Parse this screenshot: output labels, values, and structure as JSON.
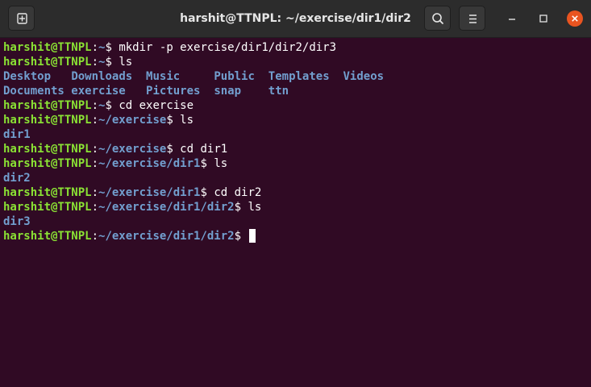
{
  "window": {
    "title": "harshit@TTNPL: ~/exercise/dir1/dir2",
    "colors": {
      "background": "#300a24",
      "titlebar": "#2c2c2c",
      "user": "#8ae234",
      "path": "#729fcf",
      "close": "#e95420"
    }
  },
  "terminal": {
    "user": "harshit@TTNPL",
    "sep": ":",
    "lines": [
      {
        "cwd": "~",
        "dollar": "$ ",
        "cmd": "mkdir -p exercise/dir1/dir2/dir3"
      },
      {
        "cwd": "~",
        "dollar": "$ ",
        "cmd": "ls"
      },
      {
        "ls": [
          "Desktop",
          "Downloads",
          "Music",
          "Public",
          "Templates",
          "Videos"
        ]
      },
      {
        "ls": [
          "Documents",
          "exercise",
          "Pictures",
          "snap",
          "ttn"
        ]
      },
      {
        "cwd": "~",
        "dollar": "$ ",
        "cmd": "cd exercise"
      },
      {
        "cwd": "~/exercise",
        "dollar": "$ ",
        "cmd": "ls"
      },
      {
        "ls": [
          "dir1"
        ]
      },
      {
        "cwd": "~/exercise",
        "dollar": "$ ",
        "cmd": "cd dir1"
      },
      {
        "cwd": "~/exercise/dir1",
        "dollar": "$ ",
        "cmd": "ls"
      },
      {
        "ls": [
          "dir2"
        ]
      },
      {
        "cwd": "~/exercise/dir1",
        "dollar": "$ ",
        "cmd": "cd dir2"
      },
      {
        "cwd": "~/exercise/dir1/dir2",
        "dollar": "$ ",
        "cmd": "ls"
      },
      {
        "ls": [
          "dir3"
        ]
      },
      {
        "cwd": "~/exercise/dir1/dir2",
        "dollar": "$ ",
        "cmd": "",
        "cursor": true
      }
    ]
  }
}
